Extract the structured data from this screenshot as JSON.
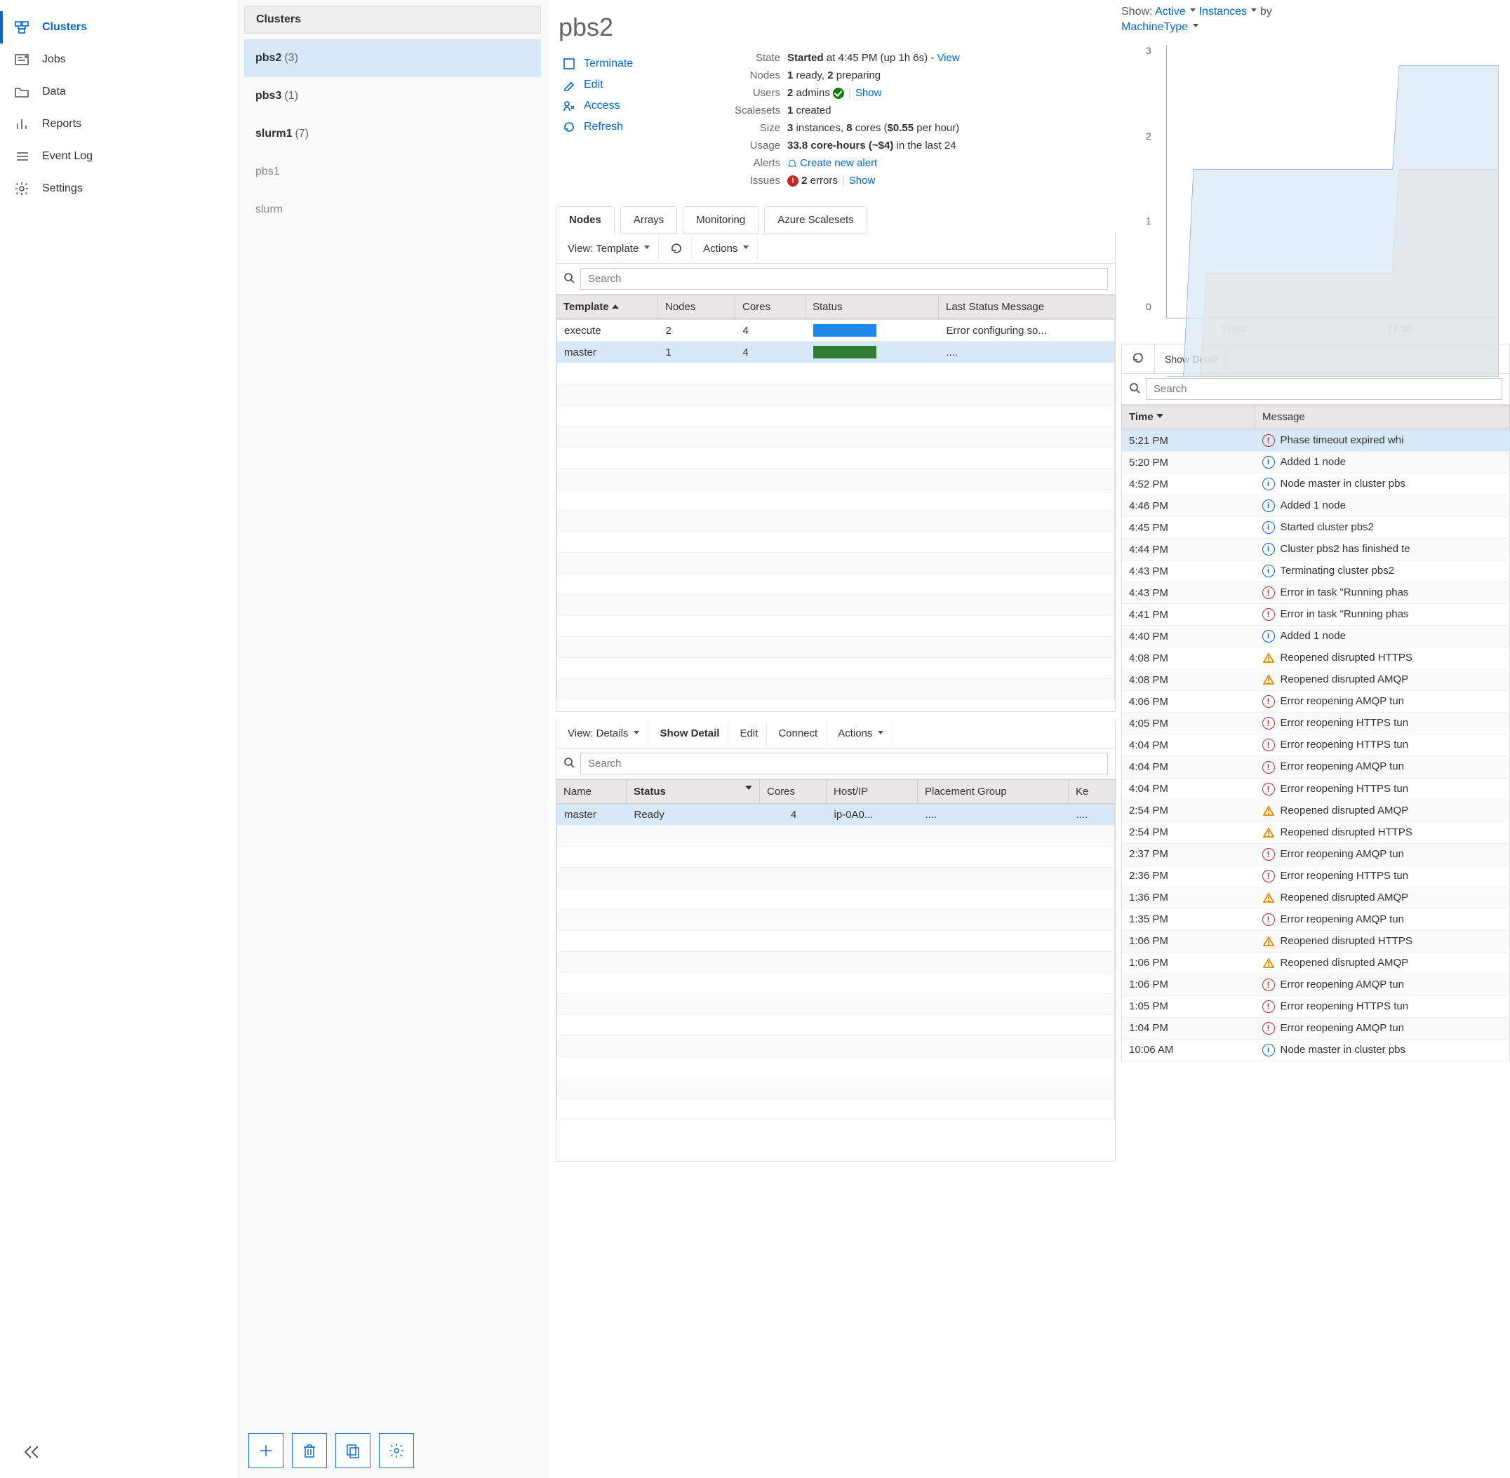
{
  "nav": {
    "items": [
      {
        "label": "Clusters",
        "icon": "clusters"
      },
      {
        "label": "Jobs",
        "icon": "jobs"
      },
      {
        "label": "Data",
        "icon": "folder"
      },
      {
        "label": "Reports",
        "icon": "chart"
      },
      {
        "label": "Event Log",
        "icon": "list"
      },
      {
        "label": "Settings",
        "icon": "gear"
      }
    ]
  },
  "clusters": {
    "header": "Clusters",
    "items": [
      {
        "name": "pbs2",
        "cnt": "(3)",
        "selected": true
      },
      {
        "name": "pbs3",
        "cnt": "(1)"
      },
      {
        "name": "slurm1",
        "cnt": "(7)"
      },
      {
        "name": "pbs1",
        "dim": true
      },
      {
        "name": "slurm",
        "dim": true
      }
    ]
  },
  "cluster": {
    "title": "pbs2",
    "actions": {
      "terminate": "Terminate",
      "edit": "Edit",
      "access": "Access",
      "refresh": "Refresh"
    },
    "meta": {
      "state_label": "State",
      "state_val": "Started",
      "state_extra": " at 4:45 PM (up 1h 6s) - ",
      "state_view": "View",
      "nodes_label": "Nodes",
      "nodes_ready": "1",
      "nodes_ready_t": " ready, ",
      "nodes_prep": "2",
      "nodes_prep_t": " preparing",
      "users_label": "Users",
      "users_n": "2",
      "users_t": " admins ",
      "users_show": "Show",
      "scalesets_label": "Scalesets",
      "scalesets_n": "1",
      "scalesets_t": " created",
      "size_label": "Size",
      "size_inst": "3",
      "size_inst_t": " instances, ",
      "size_cores": "8",
      "size_cores_t": " cores (",
      "size_cost": "$0.55",
      "size_cost_t": " per hour)",
      "usage_label": "Usage",
      "usage_n": "33.8 core-hours (~$4)",
      "usage_t": " in the last 24",
      "alerts_label": "Alerts",
      "alerts_link": "Create new alert",
      "issues_label": "Issues",
      "issues_n": "2",
      "issues_t": " errors",
      "issues_show": "Show"
    },
    "tabs": [
      "Nodes",
      "Arrays",
      "Monitoring",
      "Azure Scalesets"
    ],
    "nodesPane": {
      "view_label": "View: Template",
      "actions_label": "Actions",
      "search_ph": "Search",
      "headers": [
        "Template",
        "Nodes",
        "Cores",
        "Status",
        "Last Status Message"
      ],
      "rows": [
        {
          "tpl": "execute",
          "nodes": "2",
          "cores": "4",
          "bar": "blue",
          "msg": "Error configuring so..."
        },
        {
          "tpl": "master",
          "nodes": "1",
          "cores": "4",
          "bar": "green",
          "msg": "...."
        }
      ]
    },
    "detailPane": {
      "view_label": "View: Details",
      "show_detail": "Show Detail",
      "edit": "Edit",
      "connect": "Connect",
      "actions": "Actions",
      "search_ph": "Search",
      "headers": [
        "Name",
        "Status",
        "Cores",
        "Host/IP",
        "Placement Group",
        "Ke"
      ],
      "rows": [
        {
          "name": "master",
          "status": "Ready",
          "cores": "4",
          "host": "ip-0A0...",
          "pg": "....",
          "ke": "...."
        }
      ]
    }
  },
  "right": {
    "show_pre": "Show: ",
    "active": "Active",
    "instances": "Instances",
    "by": " by",
    "mt": "MachineType",
    "show_detail": "Show Detail",
    "search_ph": "Search",
    "ev_headers": [
      "Time",
      "Message"
    ],
    "events": [
      {
        "t": "5:21 PM",
        "k": "err",
        "m": "Phase timeout expired whi"
      },
      {
        "t": "5:20 PM",
        "k": "info",
        "m": "Added 1 node"
      },
      {
        "t": "4:52 PM",
        "k": "info",
        "m": "Node master in cluster pbs"
      },
      {
        "t": "4:46 PM",
        "k": "info",
        "m": "Added 1 node"
      },
      {
        "t": "4:45 PM",
        "k": "info",
        "m": "Started cluster pbs2"
      },
      {
        "t": "4:44 PM",
        "k": "info",
        "m": "Cluster pbs2 has finished te"
      },
      {
        "t": "4:43 PM",
        "k": "info",
        "m": "Terminating cluster pbs2"
      },
      {
        "t": "4:43 PM",
        "k": "err",
        "m": "Error in task \"Running phas"
      },
      {
        "t": "4:41 PM",
        "k": "err",
        "m": "Error in task \"Running phas"
      },
      {
        "t": "4:40 PM",
        "k": "info",
        "m": "Added 1 node"
      },
      {
        "t": "4:08 PM",
        "k": "warn",
        "m": "Reopened disrupted HTTPS"
      },
      {
        "t": "4:08 PM",
        "k": "warn",
        "m": "Reopened disrupted AMQP"
      },
      {
        "t": "4:06 PM",
        "k": "err",
        "m": "Error reopening AMQP tun"
      },
      {
        "t": "4:05 PM",
        "k": "err",
        "m": "Error reopening HTTPS tun"
      },
      {
        "t": "4:04 PM",
        "k": "err",
        "m": "Error reopening HTTPS tun"
      },
      {
        "t": "4:04 PM",
        "k": "err",
        "m": "Error reopening AMQP tun"
      },
      {
        "t": "4:04 PM",
        "k": "err",
        "m": "Error reopening HTTPS tun"
      },
      {
        "t": "2:54 PM",
        "k": "warn",
        "m": "Reopened disrupted AMQP"
      },
      {
        "t": "2:54 PM",
        "k": "warn",
        "m": "Reopened disrupted HTTPS"
      },
      {
        "t": "2:37 PM",
        "k": "err",
        "m": "Error reopening AMQP tun"
      },
      {
        "t": "2:36 PM",
        "k": "err",
        "m": "Error reopening HTTPS tun"
      },
      {
        "t": "1:36 PM",
        "k": "warn",
        "m": "Reopened disrupted AMQP"
      },
      {
        "t": "1:35 PM",
        "k": "err",
        "m": "Error reopening AMQP tun"
      },
      {
        "t": "1:06 PM",
        "k": "warn",
        "m": "Reopened disrupted HTTPS"
      },
      {
        "t": "1:06 PM",
        "k": "warn",
        "m": "Reopened disrupted AMQP"
      },
      {
        "t": "1:06 PM",
        "k": "err",
        "m": "Error reopening AMQP tun"
      },
      {
        "t": "1:05 PM",
        "k": "err",
        "m": "Error reopening HTTPS tun"
      },
      {
        "t": "1:04 PM",
        "k": "err",
        "m": "Error reopening AMQP tun"
      },
      {
        "t": "10:06 AM",
        "k": "info",
        "m": "Node master in cluster pbs"
      }
    ]
  },
  "chart_data": {
    "type": "area",
    "xlabel_ticks": [
      "17:00",
      "17:30"
    ],
    "ylabel_ticks": [
      0,
      1,
      2,
      3
    ],
    "ylim": [
      0,
      3.2
    ],
    "series": [
      {
        "name": "series-orange",
        "color": "#fbe2c8",
        "stroke": "#e3963b",
        "points": [
          [
            0,
            0
          ],
          [
            0.1,
            0
          ],
          [
            0.12,
            1
          ],
          [
            0.68,
            1
          ],
          [
            0.7,
            2
          ],
          [
            1,
            2
          ]
        ]
      },
      {
        "name": "series-blue",
        "color": "#d8e7f5",
        "stroke": "#4f84c4",
        "points": [
          [
            0,
            0
          ],
          [
            0.05,
            0
          ],
          [
            0.08,
            2
          ],
          [
            0.68,
            2
          ],
          [
            0.7,
            3
          ],
          [
            1,
            3
          ]
        ]
      }
    ]
  }
}
